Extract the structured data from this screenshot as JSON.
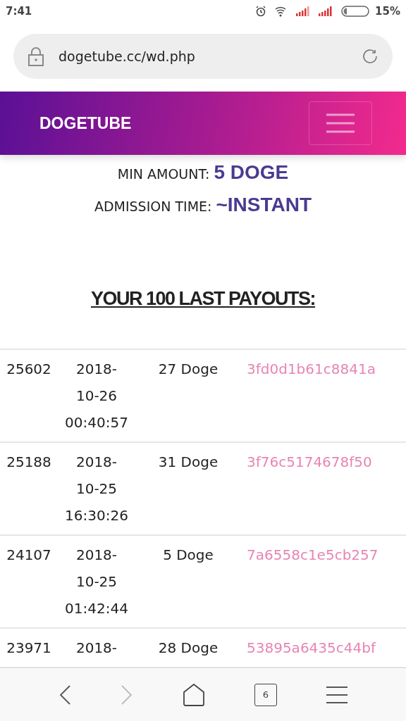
{
  "status_bar": {
    "time": "7:41",
    "battery": "15%"
  },
  "address_bar": {
    "url": "dogetube.cc/wd.php"
  },
  "navbar": {
    "brand": "DOGETUBE"
  },
  "info": [
    {
      "label": "MIN AMOUNT:",
      "value": "5 DOGE"
    },
    {
      "label": "ADMISSION TIME:",
      "value": "~INSTANT"
    }
  ],
  "payouts_title": "YOUR 100 LAST PAYOUTS:",
  "payouts": [
    {
      "id": "25602",
      "date": [
        "2018-",
        "10-26",
        "00:40:57"
      ],
      "amount": "27 Doge",
      "hash": "3fd0d1b61c8841a"
    },
    {
      "id": "25188",
      "date": [
        "2018-",
        "10-25",
        "16:30:26"
      ],
      "amount": "31 Doge",
      "hash": "3f76c5174678f50"
    },
    {
      "id": "24107",
      "date": [
        "2018-",
        "10-25",
        "01:42:44"
      ],
      "amount": "5 Doge",
      "hash": "7a6558c1e5cb257"
    },
    {
      "id": "23971",
      "date": [
        "2018-"
      ],
      "amount": "28 Doge",
      "hash": "53895a6435c44bf"
    }
  ],
  "bottom_nav": {
    "tabs_count": "6",
    "forward_disabled": true
  }
}
